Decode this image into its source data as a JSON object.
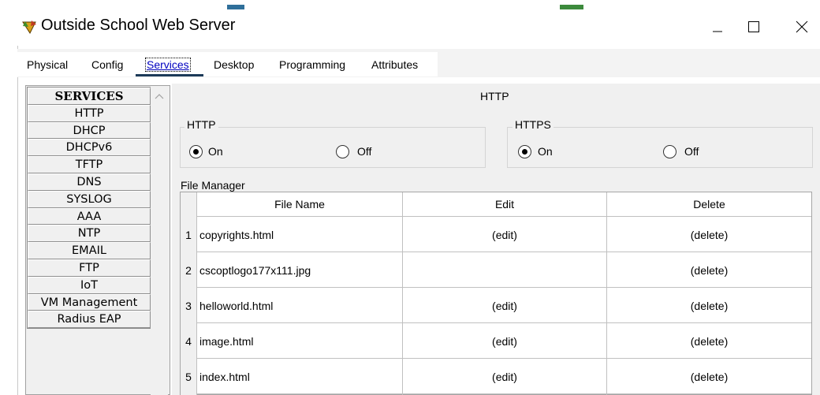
{
  "window": {
    "title": "Outside School Web Server",
    "controls": {
      "minimize": "minimize-icon",
      "maximize": "maximize-icon",
      "close": "close-icon"
    }
  },
  "tabs": [
    {
      "label": "Physical",
      "active": false
    },
    {
      "label": "Config",
      "active": false
    },
    {
      "label": "Services",
      "active": true
    },
    {
      "label": "Desktop",
      "active": false
    },
    {
      "label": "Programming",
      "active": false
    },
    {
      "label": "Attributes",
      "active": false
    }
  ],
  "sidebar": {
    "header": "SERVICES",
    "items": [
      {
        "label": "HTTP"
      },
      {
        "label": "DHCP"
      },
      {
        "label": "DHCPv6"
      },
      {
        "label": "TFTP"
      },
      {
        "label": "DNS"
      },
      {
        "label": "SYSLOG"
      },
      {
        "label": "AAA"
      },
      {
        "label": "NTP"
      },
      {
        "label": "EMAIL"
      },
      {
        "label": "FTP"
      },
      {
        "label": "IoT"
      },
      {
        "label": "VM Management"
      },
      {
        "label": "Radius EAP"
      }
    ]
  },
  "main": {
    "heading": "HTTP",
    "http_group": {
      "label": "HTTP",
      "on_label": "On",
      "off_label": "Off",
      "selected": "On"
    },
    "https_group": {
      "label": "HTTPS",
      "on_label": "On",
      "off_label": "Off",
      "selected": "On"
    },
    "file_manager": {
      "label": "File Manager",
      "columns": [
        "File Name",
        "Edit",
        "Delete"
      ],
      "rows": [
        {
          "num": "1",
          "name": "copyrights.html",
          "edit": "(edit)",
          "delete": "(delete)"
        },
        {
          "num": "2",
          "name": "cscoptlogo177x111.jpg",
          "edit": "",
          "delete": "(delete)"
        },
        {
          "num": "3",
          "name": "helloworld.html",
          "edit": "(edit)",
          "delete": "(delete)"
        },
        {
          "num": "4",
          "name": "image.html",
          "edit": "(edit)",
          "delete": "(delete)"
        },
        {
          "num": "5",
          "name": "index.html",
          "edit": "(edit)",
          "delete": "(delete)"
        }
      ]
    }
  },
  "colors": {
    "panel_bg": "#f0f0f0",
    "tab_underline": "#1c3a58",
    "active_tab_text": "#0000c0"
  }
}
